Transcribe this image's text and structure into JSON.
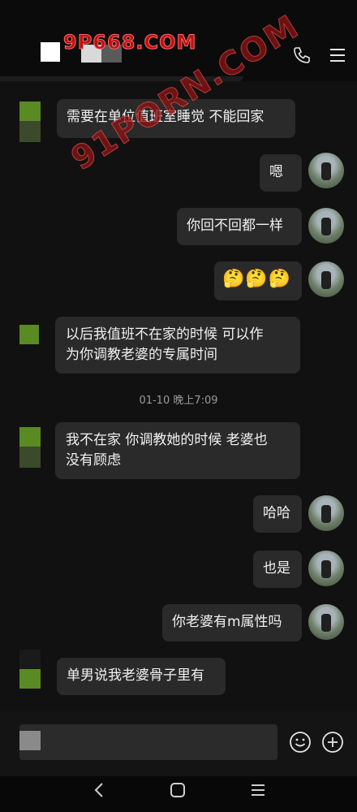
{
  "watermark": "9P668.COM",
  "watermark_diag": "91PORN.COM",
  "header": {
    "phone_icon": "phone-icon",
    "menu_icon": "menu-icon"
  },
  "messages": [
    {
      "side": "left",
      "text_lines": [
        "需要在单位值班室睡觉  不能回家"
      ]
    },
    {
      "side": "right",
      "text_lines": [
        "嗯"
      ]
    },
    {
      "side": "right",
      "text_lines": [
        "你回不回都一样"
      ]
    },
    {
      "side": "right",
      "text_lines": [
        "🤔🤔🤔"
      ]
    },
    {
      "side": "left",
      "text_lines": [
        "以后我值班不在家的时候  可以作",
        "为你调教老婆的专属时间"
      ]
    },
    {
      "side": "left",
      "text_lines": [
        "我不在家  你调教她的时候  老婆也",
        "没有顾虑"
      ]
    },
    {
      "side": "right",
      "text_lines": [
        "哈哈"
      ]
    },
    {
      "side": "right",
      "text_lines": [
        "也是"
      ]
    },
    {
      "side": "right",
      "text_lines": [
        "你老婆有m属性吗"
      ]
    },
    {
      "side": "left",
      "text_lines": [
        "单男说我老婆骨子里有"
      ]
    }
  ],
  "timestamp": "01-10 晚上7:09",
  "input": {
    "placeholder": ""
  },
  "colors": {
    "bg": "#111111",
    "bubble": "#2a2a2a",
    "avatar_green": "#5a8a24"
  },
  "navbar": {
    "back_icon": "back-icon",
    "home_icon": "home-icon",
    "menu_icon": "recent-apps-icon"
  }
}
